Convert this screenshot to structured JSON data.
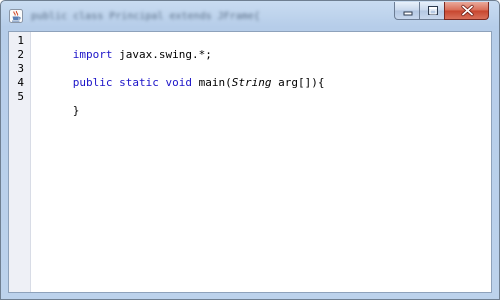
{
  "window": {
    "title": "public class Principal extends JFrame{"
  },
  "icons": {
    "app": "java-cup-icon",
    "minimize": "minimize-icon",
    "maximize": "maximize-icon",
    "close": "close-icon"
  },
  "editor": {
    "line_numbers": [
      "1",
      "2",
      "3",
      "4",
      "5"
    ],
    "lines": [
      {
        "tokens": [
          {
            "text": "import",
            "style": "keyword"
          },
          {
            "text": " javax.swing.*;",
            "style": "plain"
          }
        ]
      },
      {
        "tokens": []
      },
      {
        "tokens": [
          {
            "text": "public static void",
            "style": "keyword"
          },
          {
            "text": " main(",
            "style": "plain"
          },
          {
            "text": "String",
            "style": "italic"
          },
          {
            "text": " arg[]){",
            "style": "plain"
          }
        ]
      },
      {
        "tokens": []
      },
      {
        "tokens": [
          {
            "text": "}",
            "style": "plain"
          }
        ]
      }
    ]
  },
  "colors": {
    "keyword": "#1c14c8",
    "title_bar": "#bcd2ec",
    "close_button": "#c7452e",
    "gutter": "#eef0f6"
  }
}
